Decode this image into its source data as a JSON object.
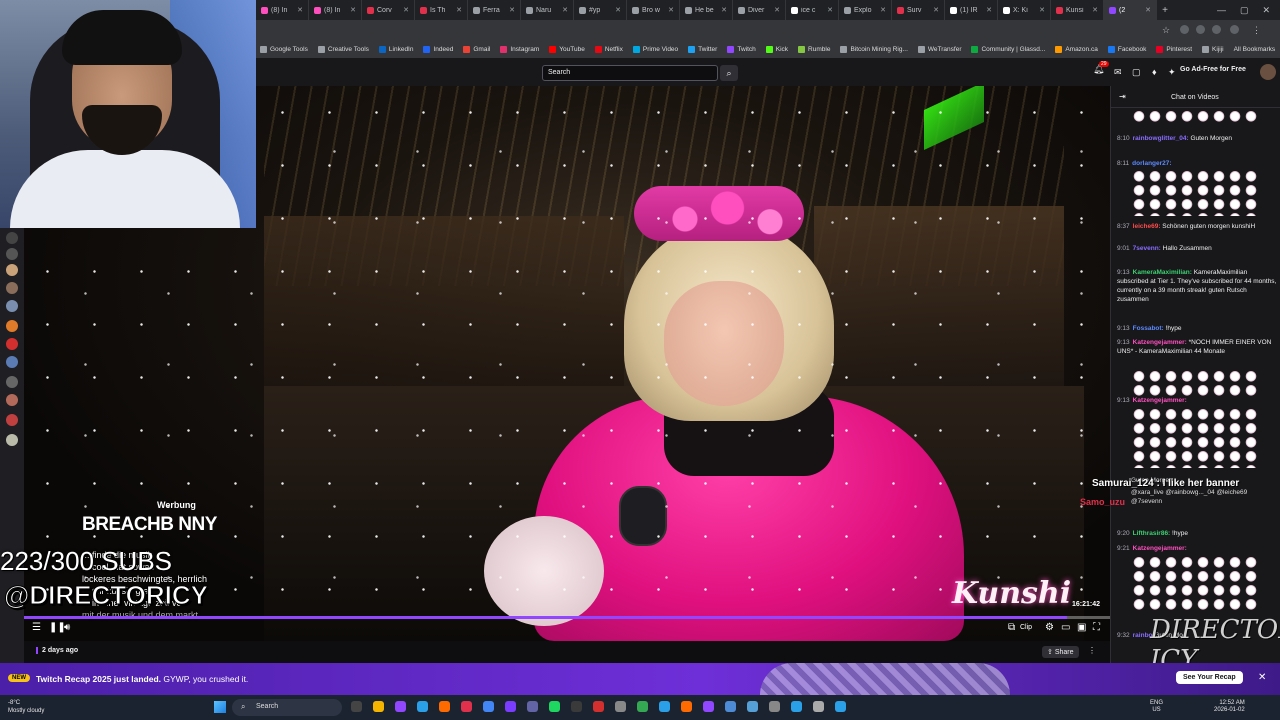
{
  "browser": {
    "tabs": [
      {
        "label": "(8) In",
        "color": "#ff4fbf"
      },
      {
        "label": "(8) In",
        "color": "#ff4fbf"
      },
      {
        "label": "Corv",
        "color": "#e0304b"
      },
      {
        "label": "Is Th",
        "color": "#e0304b"
      },
      {
        "label": "Ferra",
        "color": "#9aa0a6"
      },
      {
        "label": "Naru",
        "color": "#9aa0a6"
      },
      {
        "label": "#yp",
        "color": "#9aa0a6"
      },
      {
        "label": "Bro w",
        "color": "#9aa0a6"
      },
      {
        "label": "He be",
        "color": "#9aa0a6"
      },
      {
        "label": "Diver",
        "color": "#9aa0a6"
      },
      {
        "label": "ice c",
        "color": "#ffffff"
      },
      {
        "label": "Explo",
        "color": "#9aa0a6"
      },
      {
        "label": "Surv",
        "color": "#e0304b"
      },
      {
        "label": "(1) IR",
        "color": "#ffffff"
      },
      {
        "label": "X: Ki",
        "color": "#ffffff"
      },
      {
        "label": "Kunsi",
        "color": "#e0304b"
      },
      {
        "label": "(2",
        "color": "#9147ff"
      }
    ],
    "new_tab": "+",
    "bookmarks": [
      {
        "label": "Google Tools",
        "color": "#9aa0a6"
      },
      {
        "label": "Creative Tools",
        "color": "#9aa0a6"
      },
      {
        "label": "LinkedIn",
        "color": "#0a66c2"
      },
      {
        "label": "Indeed",
        "color": "#2164f3"
      },
      {
        "label": "Gmail",
        "color": "#ea4335"
      },
      {
        "label": "Instagram",
        "color": "#e1306c"
      },
      {
        "label": "YouTube",
        "color": "#ff0000"
      },
      {
        "label": "Netflix",
        "color": "#e50914"
      },
      {
        "label": "Prime Video",
        "color": "#00a8e1"
      },
      {
        "label": "Twitter",
        "color": "#1da1f2"
      },
      {
        "label": "Twitch",
        "color": "#9147ff"
      },
      {
        "label": "Kick",
        "color": "#53fc18"
      },
      {
        "label": "Rumble",
        "color": "#85c742"
      },
      {
        "label": "Bitcoin Mining Rig...",
        "color": "#9aa0a6"
      },
      {
        "label": "WeTransfer",
        "color": "#9aa0a6"
      },
      {
        "label": "Community | Glassd...",
        "color": "#0caa41"
      },
      {
        "label": "Amazon.ca",
        "color": "#ff9900"
      },
      {
        "label": "Facebook",
        "color": "#1877f2"
      },
      {
        "label": "Pinterest",
        "color": "#e60023"
      },
      {
        "label": "Kijiji",
        "color": "#9aa0a6"
      }
    ],
    "all_bookmarks": "All Bookmarks"
  },
  "twitch": {
    "search_placeholder": "Search",
    "notifications_count": "29",
    "ad_free": "Go Ad-Free for Free"
  },
  "video": {
    "werbung": "Werbung",
    "breach_brand": "BREACHB NNY",
    "overlay_chat": [
      "...   finde die musik",
      "... cool. hat sowas",
      "lockeres beschwingtes, herrlich",
      "...           mir kunshi grad",
      "... in einer vintage zeit vor",
      "mit der musik und dem markt"
    ],
    "subs_counter": "223/300 SUBS",
    "handle": "@DIRECTORICY",
    "watermark": "Kunshi",
    "timecode": "16:21:42",
    "progress": 0.96,
    "clip_label": "Clip"
  },
  "below_video": {
    "age": "2 days ago",
    "share": "Share"
  },
  "chat": {
    "title": "Chat on Videos",
    "messages": [
      {
        "time": "8:10",
        "user": "rainbowglitter_04:",
        "color": "#8a6dff",
        "text": "Guten Morgen"
      },
      {
        "time": "8:11",
        "user": "dorlanger27:",
        "color": "#5c8aff",
        "text": ""
      },
      {
        "time": "8:37",
        "user": "leiche69:",
        "color": "#ff4b4b",
        "text": "Schönen guten morgen kunshiH"
      },
      {
        "time": "9:01",
        "user": "7sevenn:",
        "color": "#8a6dff",
        "text": "Hallo Zusammen"
      },
      {
        "time": "9:13",
        "user": "KameraMaximilian:",
        "color": "#3bd16f",
        "text": "KameraMaximilian subscribed at Tier 1. They've subscribed for 44 months, currently on a 39 month streak! guten Rutsch zusammen"
      },
      {
        "time": "9:13",
        "user": "Fossabot:",
        "color": "#5c8aff",
        "text": "!hype"
      },
      {
        "time": "9:13",
        "user": "Katzengejammer:",
        "color": "#ff4fbf",
        "text": "*NOCH IMMER EINER VON UNS* - KameraMaximilian 44 Monate"
      },
      {
        "time": "9:13",
        "user": "Katzengejammer:",
        "color": "#ff4fbf",
        "text": ""
      },
      {
        "time": "9:20",
        "user": "Lifthrasir86:",
        "color": "#3bd16f",
        "text": "!hype"
      },
      {
        "time": "9:21",
        "user": "Katzengejammer:",
        "color": "#ff4fbf",
        "text": ""
      },
      {
        "time": "9:32",
        "user": "rainbo",
        "color": "#8a6dff",
        "text": "Guten Mo"
      }
    ],
    "overlay_message": "Samurai_124 : I like her banner",
    "overlay_user2": "Samo_uzu",
    "overlay_reply": "@xara_live @rainbowg..._04 @leiche69 @7sevenn",
    "overlay_reply_head": "Guten Morgen",
    "director_logo": "DIRECTOR ICY"
  },
  "recap": {
    "badge": "NEW",
    "title": "Twitch Recap 2025 just landed.",
    "subtitle": "GYWP, you crushed it.",
    "button": "See Your Recap"
  },
  "taskbar": {
    "weather_temp": "-8°C",
    "weather_desc": "Mostly cloudy",
    "search": "Search",
    "lang1": "ENG",
    "lang2": "US",
    "time": "12:52 AM",
    "date": "2026-01-02"
  }
}
